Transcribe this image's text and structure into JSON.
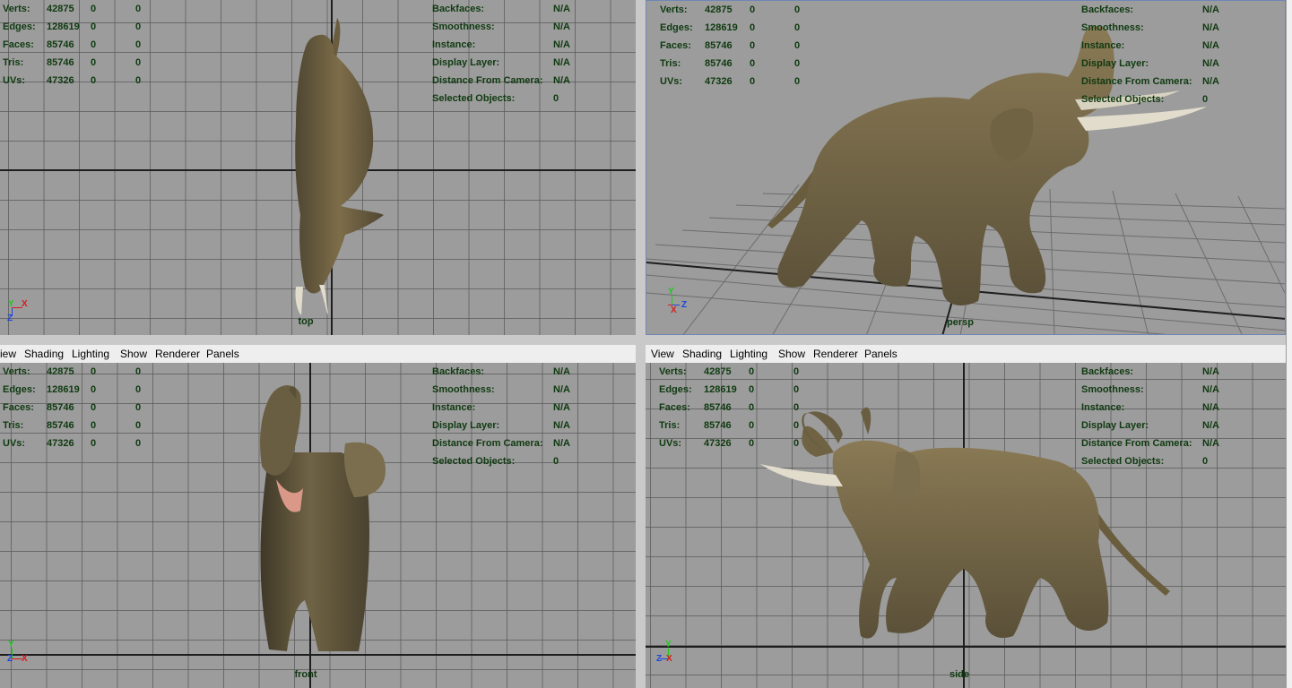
{
  "menu": {
    "view": "View",
    "shading": "Shading",
    "lighting": "Lighting",
    "show": "Show",
    "renderer": "Renderer",
    "panels": "Panels"
  },
  "view_menu_clipped": "iew",
  "stats_labels": {
    "verts": "Verts:",
    "edges": "Edges:",
    "faces": "Faces:",
    "tris": "Tris:",
    "uvs": "UVs:"
  },
  "stats_values": {
    "verts": [
      "42875",
      "0",
      "0"
    ],
    "edges": [
      "128619",
      "0",
      "0"
    ],
    "faces": [
      "85746",
      "0",
      "0"
    ],
    "tris": [
      "85746",
      "0",
      "0"
    ],
    "uvs": [
      "47326",
      "0",
      "0"
    ]
  },
  "info_labels": {
    "backfaces": "Backfaces:",
    "smoothness": "Smoothness:",
    "instance": "Instance:",
    "display_layer": "Display Layer:",
    "distance": "Distance From Camera:",
    "selected": "Selected Objects:"
  },
  "info_values": {
    "backfaces": "N/A",
    "smoothness": "N/A",
    "instance": "N/A",
    "display_layer": "N/A",
    "distance": "N/A",
    "selected": "0"
  },
  "cameras": {
    "top": "top",
    "persp": "persp",
    "front": "front",
    "side": "side"
  },
  "axis_letters": {
    "x": "X",
    "y": "Y",
    "z": "Z"
  },
  "colors": {
    "viewport_bg": "#9c9c9c",
    "grid": "#5a5a5a",
    "hud_text": "#0f3a10",
    "axis_x": "#d21e1e",
    "axis_y": "#1ec81e",
    "axis_z": "#1e46dc",
    "persp_border": "#6e86b6",
    "skin": "#7d6d49"
  }
}
